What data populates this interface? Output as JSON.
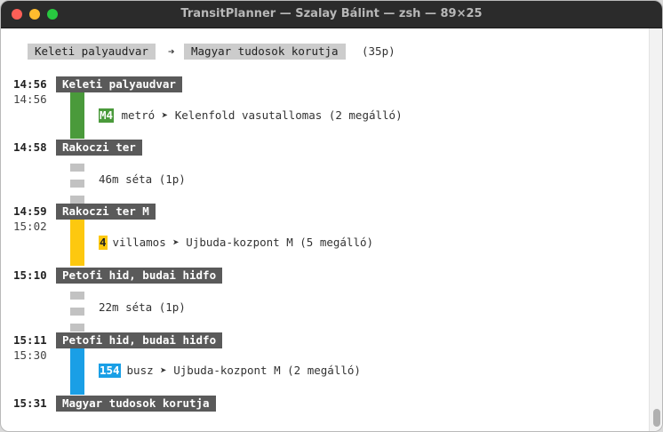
{
  "window": {
    "title": "TransitPlanner — Szalay Bálint — zsh — 89×25"
  },
  "route": {
    "from": "Keleti palyaudvar",
    "arrow": "➔",
    "to": "Magyar tudosok korutja",
    "duration": "(35p)"
  },
  "colors": {
    "m4": "#4a9a3b",
    "tram4": "#fdc80f",
    "bus154": "#1a9fe6",
    "walk": "#c2c2c2",
    "stop_bg": "#5a5a5a",
    "chip_bg": "#cccccc"
  },
  "stops": [
    {
      "time": "14:56",
      "name": "Keleti palyaudvar"
    },
    {
      "time": "14:58",
      "name": "Rakoczi ter"
    },
    {
      "time": "14:59",
      "name": "Rakoczi ter M"
    },
    {
      "time": "15:10",
      "name": "Petofi hid, budai hidfo"
    },
    {
      "time": "15:11",
      "name": "Petofi hid, budai hidfo"
    },
    {
      "time": "15:31",
      "name": "Magyar tudosok korutja"
    }
  ],
  "legs": [
    {
      "depart": "14:56",
      "line": "M4",
      "desc": " metró ➤ Kelenfold vasutallomas (2 megálló)"
    },
    {
      "desc": "46m séta (1p)"
    },
    {
      "depart": "15:02",
      "line": "4",
      "desc": " villamos ➤ Ujbuda-kozpont M (5 megálló)"
    },
    {
      "desc": "22m séta (1p)"
    },
    {
      "depart": "15:30",
      "line": "154",
      "desc": " busz ➤ Ujbuda-kozpont M (2 megálló)"
    }
  ]
}
